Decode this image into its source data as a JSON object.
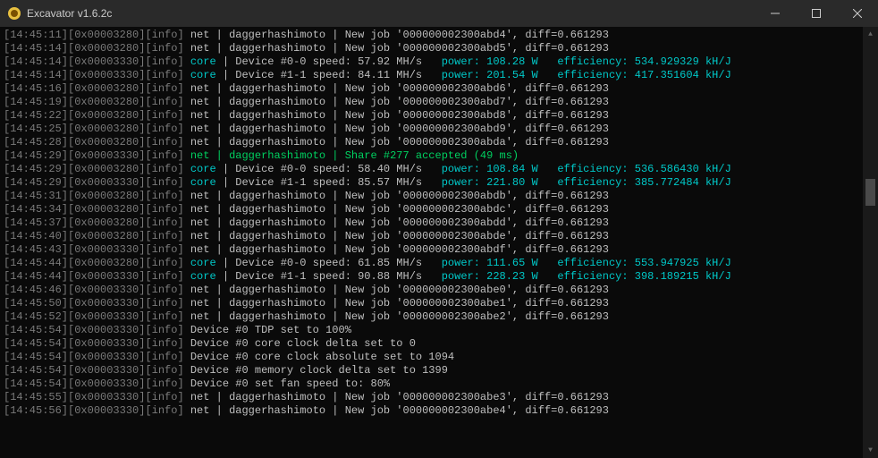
{
  "window": {
    "title": "Excavator v1.6.2c"
  },
  "lines": [
    {
      "t": "14:45:11",
      "a": "0x00003280",
      "l": "info",
      "k": "job",
      "c": "net",
      "alg": "daggerhashimoto",
      "job": "000000002300abd4",
      "diff": "0.661293"
    },
    {
      "t": "14:45:14",
      "a": "0x00003280",
      "l": "info",
      "k": "job",
      "c": "net",
      "alg": "daggerhashimoto",
      "job": "000000002300abd5",
      "diff": "0.661293"
    },
    {
      "t": "14:45:14",
      "a": "0x00003330",
      "l": "info",
      "k": "core",
      "dev": "#0-0",
      "spd": "57.92",
      "pow": "108.28",
      "eff": "534.929329"
    },
    {
      "t": "14:45:14",
      "a": "0x00003330",
      "l": "info",
      "k": "core",
      "dev": "#1-1",
      "spd": "84.11",
      "pow": "201.54",
      "eff": "417.351604"
    },
    {
      "t": "14:45:16",
      "a": "0x00003280",
      "l": "info",
      "k": "job",
      "c": "net",
      "alg": "daggerhashimoto",
      "job": "000000002300abd6",
      "diff": "0.661293"
    },
    {
      "t": "14:45:19",
      "a": "0x00003280",
      "l": "info",
      "k": "job",
      "c": "net",
      "alg": "daggerhashimoto",
      "job": "000000002300abd7",
      "diff": "0.661293"
    },
    {
      "t": "14:45:22",
      "a": "0x00003280",
      "l": "info",
      "k": "job",
      "c": "net",
      "alg": "daggerhashimoto",
      "job": "000000002300abd8",
      "diff": "0.661293"
    },
    {
      "t": "14:45:25",
      "a": "0x00003280",
      "l": "info",
      "k": "job",
      "c": "net",
      "alg": "daggerhashimoto",
      "job": "000000002300abd9",
      "diff": "0.661293"
    },
    {
      "t": "14:45:28",
      "a": "0x00003280",
      "l": "info",
      "k": "job",
      "c": "net",
      "alg": "daggerhashimoto",
      "job": "000000002300abda",
      "diff": "0.661293"
    },
    {
      "t": "14:45:29",
      "a": "0x00003330",
      "l": "info",
      "k": "share",
      "c": "net",
      "alg": "daggerhashimoto",
      "share": "#277",
      "ms": "49"
    },
    {
      "t": "14:45:29",
      "a": "0x00003280",
      "l": "info",
      "k": "core",
      "dev": "#0-0",
      "spd": "58.40",
      "pow": "108.84",
      "eff": "536.586430"
    },
    {
      "t": "14:45:29",
      "a": "0x00003330",
      "l": "info",
      "k": "core",
      "dev": "#1-1",
      "spd": "85.57",
      "pow": "221.80",
      "eff": "385.772484"
    },
    {
      "t": "14:45:31",
      "a": "0x00003280",
      "l": "info",
      "k": "job",
      "c": "net",
      "alg": "daggerhashimoto",
      "job": "000000002300abdb",
      "diff": "0.661293"
    },
    {
      "t": "14:45:34",
      "a": "0x00003280",
      "l": "info",
      "k": "job",
      "c": "net",
      "alg": "daggerhashimoto",
      "job": "000000002300abdc",
      "diff": "0.661293"
    },
    {
      "t": "14:45:37",
      "a": "0x00003280",
      "l": "info",
      "k": "job",
      "c": "net",
      "alg": "daggerhashimoto",
      "job": "000000002300abdd",
      "diff": "0.661293"
    },
    {
      "t": "14:45:40",
      "a": "0x00003280",
      "l": "info",
      "k": "job",
      "c": "net",
      "alg": "daggerhashimoto",
      "job": "000000002300abde",
      "diff": "0.661293"
    },
    {
      "t": "14:45:43",
      "a": "0x00003330",
      "l": "info",
      "k": "job",
      "c": "net",
      "alg": "daggerhashimoto",
      "job": "000000002300abdf",
      "diff": "0.661293"
    },
    {
      "t": "14:45:44",
      "a": "0x00003280",
      "l": "info",
      "k": "core",
      "dev": "#0-0",
      "spd": "61.85",
      "pow": "111.65",
      "eff": "553.947925"
    },
    {
      "t": "14:45:44",
      "a": "0x00003330",
      "l": "info",
      "k": "core",
      "dev": "#1-1",
      "spd": "90.88",
      "pow": "228.23",
      "eff": "398.189215"
    },
    {
      "t": "14:45:46",
      "a": "0x00003330",
      "l": "info",
      "k": "job",
      "c": "net",
      "alg": "daggerhashimoto",
      "job": "000000002300abe0",
      "diff": "0.661293"
    },
    {
      "t": "14:45:50",
      "a": "0x00003330",
      "l": "info",
      "k": "job",
      "c": "net",
      "alg": "daggerhashimoto",
      "job": "000000002300abe1",
      "diff": "0.661293"
    },
    {
      "t": "14:45:52",
      "a": "0x00003330",
      "l": "info",
      "k": "job",
      "c": "net",
      "alg": "daggerhashimoto",
      "job": "000000002300abe2",
      "diff": "0.661293"
    },
    {
      "t": "14:45:54",
      "a": "0x00003330",
      "l": "info",
      "k": "raw",
      "txt": "Device #0 TDP set to 100%"
    },
    {
      "t": "14:45:54",
      "a": "0x00003330",
      "l": "info",
      "k": "raw",
      "txt": "Device #0 core clock delta set to 0"
    },
    {
      "t": "14:45:54",
      "a": "0x00003330",
      "l": "info",
      "k": "raw",
      "txt": "Device #0 core clock absolute set to 1094"
    },
    {
      "t": "14:45:54",
      "a": "0x00003330",
      "l": "info",
      "k": "raw",
      "txt": "Device #0 memory clock delta set to 1399"
    },
    {
      "t": "14:45:54",
      "a": "0x00003330",
      "l": "info",
      "k": "raw",
      "txt": "Device #0 set fan speed to: 80%"
    },
    {
      "t": "14:45:55",
      "a": "0x00003330",
      "l": "info",
      "k": "job",
      "c": "net",
      "alg": "daggerhashimoto",
      "job": "000000002300abe3",
      "diff": "0.661293"
    },
    {
      "t": "14:45:56",
      "a": "0x00003330",
      "l": "info",
      "k": "job",
      "c": "net",
      "alg": "daggerhashimoto",
      "job": "000000002300abe4",
      "diff": "0.661293"
    }
  ]
}
